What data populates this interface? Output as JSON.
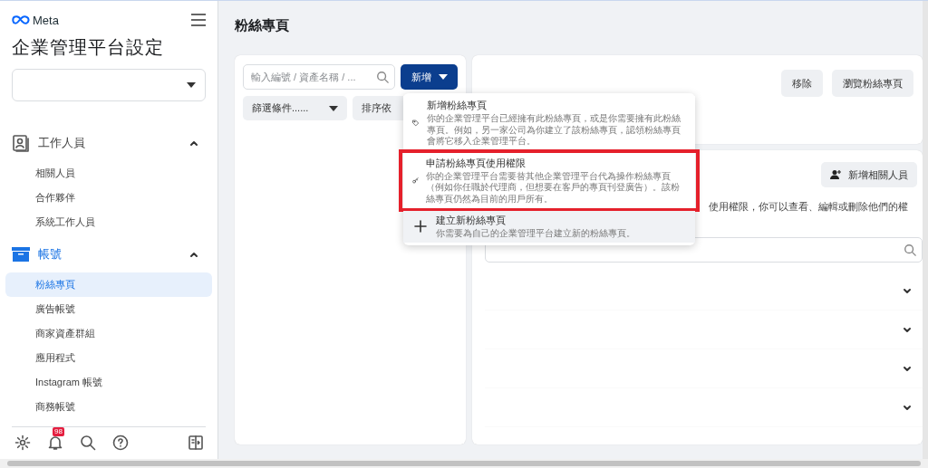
{
  "brand": "Meta",
  "title": "企業管理平台設定",
  "sections": [
    {
      "label": "工作人員",
      "kind": "people",
      "selected": false,
      "expanded": true,
      "items": [
        {
          "label": "相關人員",
          "selected": false
        },
        {
          "label": "合作夥伴",
          "selected": false
        },
        {
          "label": "系統工作人員",
          "selected": false
        }
      ]
    },
    {
      "label": "帳號",
      "kind": "box",
      "selected": true,
      "expanded": true,
      "items": [
        {
          "label": "粉絲專頁",
          "selected": true
        },
        {
          "label": "廣告帳號",
          "selected": false
        },
        {
          "label": "商家資產群組",
          "selected": false
        },
        {
          "label": "應用程式",
          "selected": false
        },
        {
          "label": "Instagram 帳號",
          "selected": false
        },
        {
          "label": "商務帳號",
          "selected": false
        }
      ]
    }
  ],
  "notification_badge": "98",
  "page_title": "粉絲專頁",
  "list_panel": {
    "search": {
      "placeholder": "輸入編號 / 資產名稱 / ..."
    },
    "add_button": "新增",
    "filter": "篩選條件......",
    "sort": "排序依"
  },
  "add_menu": [
    {
      "kind": "tag",
      "title": "新增粉絲專頁",
      "description": "你的企業管理平台已經擁有此粉絲專頁，或是你需要擁有此粉絲專頁。例如，另一家公司為你建立了該粉絲專頁，認領粉絲專頁會將它移入企業管理平台。",
      "highlighted": false,
      "hovered": false
    },
    {
      "kind": "key",
      "title": "申請粉絲專頁使用權限",
      "description": "你的企業管理平台需要替其他企業管理平台代為操作粉絲專頁（例如你任職於代理商，但想要在客戶的專頁刊登廣告）。該粉絲專頁仍然為目前的用戶所有。",
      "highlighted": true,
      "hovered": false
    },
    {
      "kind": "plus",
      "title": "建立新粉絲專頁",
      "description": "你需要為自己的企業管理平台建立新的粉絲專頁。",
      "highlighted": false,
      "hovered": true
    }
  ],
  "detail": {
    "buttons": [
      "移除",
      "瀏覽粉絲專頁"
    ],
    "add_person_button": "新增相關人員",
    "description": "使用權限，你可以查看、編輯或刪除他們的權",
    "rows": [
      {
        "expanded": false
      },
      {
        "expanded": false
      },
      {
        "expanded": false
      },
      {
        "expanded": false
      }
    ]
  }
}
